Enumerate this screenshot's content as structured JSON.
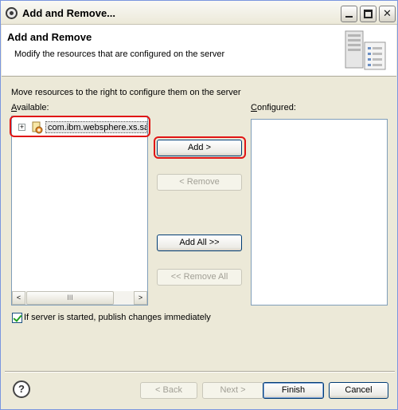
{
  "window": {
    "title": "Add and Remove...",
    "icons": [
      "eclipse-app-icon",
      "minimize-icon",
      "maximize-icon",
      "close-icon"
    ]
  },
  "banner": {
    "title": "Add and Remove",
    "description": "Modify the resources that are configured on the server",
    "icon": "server-icon"
  },
  "main": {
    "instruction": "Move resources to the right to configure them on the server",
    "available_label_mnemonic": "A",
    "available_label_rest": "vailable:",
    "configured_label_mnemonic": "C",
    "configured_label_rest": "onfigured:",
    "available_items": [
      {
        "label": "com.ibm.websphere.xs.sa",
        "expander": "+",
        "icon": "module-icon"
      }
    ],
    "configured_items": [],
    "scroll_thumb": "III",
    "scroll_left": "<",
    "scroll_right": ">"
  },
  "buttons": {
    "add": "Add >",
    "remove": "< Remove",
    "add_all": "Add All >>",
    "remove_all": "<< Remove All"
  },
  "option": {
    "publish_immediately": "If server is started, publish changes immediately",
    "checked": true
  },
  "footer": {
    "help": "?",
    "back": "< Back",
    "next": "Next >",
    "finish": "Finish",
    "cancel": "Cancel"
  },
  "colors": {
    "highlight_ring": "#e01414",
    "dialog_bg": "#ece9d8",
    "list_border": "#7f9db9"
  }
}
